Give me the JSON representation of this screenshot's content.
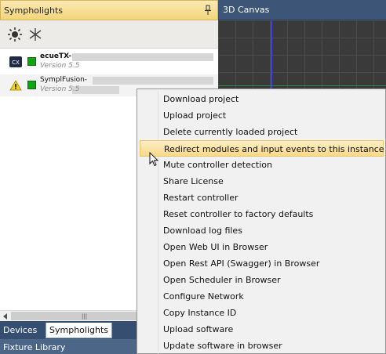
{
  "left_panel": {
    "title": "Sympholights",
    "toolbar": {
      "sun_button_icon": "sun-icon",
      "tool_button_icon": "crosshair-tool-icon"
    },
    "devices": [
      {
        "icon": "console-icon",
        "name": "ecueTX-",
        "version": "Version 5.5",
        "status_color": "#12a312"
      },
      {
        "icon": "warning-icon",
        "name": "SymplFusion-",
        "version": "Version 5.5",
        "status_color": "#12a312"
      }
    ],
    "tabs": [
      {
        "label": "Devices"
      },
      {
        "label": "Sympholights",
        "active": true
      }
    ],
    "library_title": "Fixture Library"
  },
  "canvas_panel": {
    "title": "3D Canvas"
  },
  "context_menu": {
    "items": [
      {
        "label": "Download project"
      },
      {
        "label": "Upload project"
      },
      {
        "label": "Delete currently loaded project"
      },
      {
        "label": "Redirect modules and input events to this instance",
        "highlighted": true
      },
      {
        "label": "Mute controller detection"
      },
      {
        "label": "Share License"
      },
      {
        "label": "Restart controller"
      },
      {
        "label": "Reset controller to factory defaults"
      },
      {
        "label": "Download log files"
      },
      {
        "label": "Open Web UI in Browser"
      },
      {
        "label": "Open Rest API (Swagger) in Browser"
      },
      {
        "label": "Open Scheduler in Browser"
      },
      {
        "label": "Configure Network"
      },
      {
        "label": "Copy Instance ID"
      },
      {
        "label": "Upload software"
      },
      {
        "label": "Update software in browser"
      }
    ]
  },
  "colors": {
    "header_gold": "#f2d57b",
    "tab_navy": "#364e6f",
    "menu_highlight": "#f8d98a",
    "status_green": "#12a312",
    "axis_blue": "#3f3fe6"
  }
}
